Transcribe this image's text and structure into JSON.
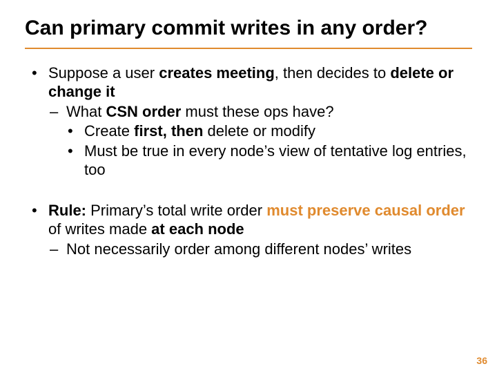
{
  "title": "Can primary commit writes in any order?",
  "block1": {
    "intro": {
      "pre": "Suppose a user ",
      "strong1": "creates meeting",
      "mid": ", then decides to ",
      "strong2": "delete or change it"
    },
    "q": {
      "pre": "What ",
      "strong": "CSN order",
      "post": " must these ops have?"
    },
    "a1": {
      "pre": "Create ",
      "strong": "first, then",
      "post": " delete or modify"
    },
    "a2": "Must be true in every node’s view of tentative log entries, too"
  },
  "block2": {
    "rule": {
      "label": "Rule:",
      "mid1": " Primary’s total write order ",
      "strong_orange": "must preserve causal order",
      "mid2": " of writes made ",
      "strong2": "at each node"
    },
    "sub": "Not necessarily order among different nodes’ writes"
  },
  "page_number": "36"
}
